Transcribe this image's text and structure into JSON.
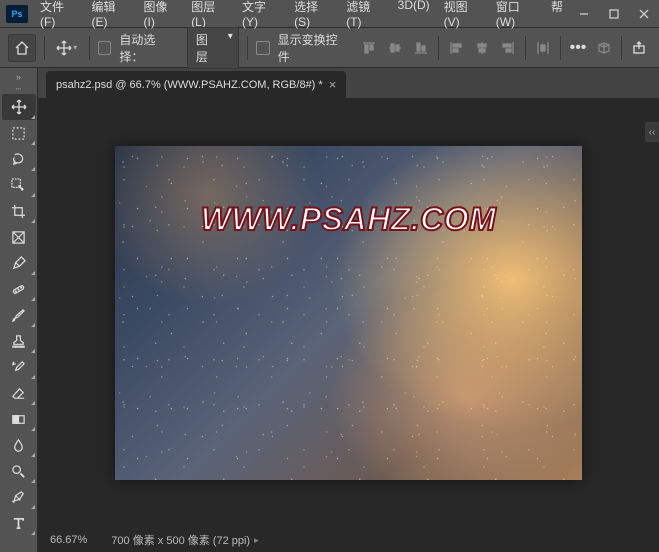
{
  "app": {
    "logo": "Ps"
  },
  "menu": [
    "文件(F)",
    "编辑(E)",
    "图像(I)",
    "图层(L)",
    "文字(Y)",
    "选择(S)",
    "滤镜(T)",
    "3D(D)",
    "视图(V)",
    "窗口(W)",
    "帮"
  ],
  "options": {
    "auto_select_label": "自动选择：",
    "dropdown_value": "图层",
    "transform_label": "显示变换控件"
  },
  "tab": {
    "label": "psahz2.psd @ 66.7% (WWW.PSAHZ.COM, RGB/8#) *"
  },
  "canvas": {
    "watermark": "WWW.PSAHZ.COM"
  },
  "status": {
    "zoom": "66.67%",
    "dims": "700 像素 x 500 像素 (72 ppi)"
  }
}
